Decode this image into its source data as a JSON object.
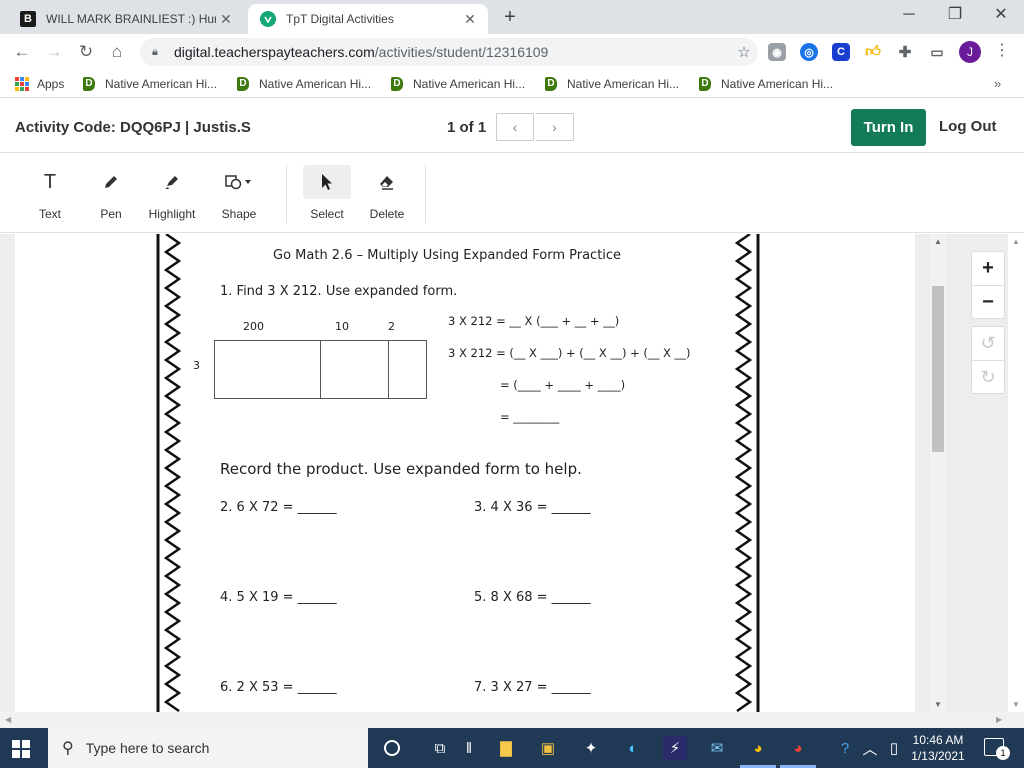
{
  "browser": {
    "tabs": [
      {
        "title": "WILL MARK BRAINLIEST :) Human",
        "favicon": "B"
      },
      {
        "title": "TpT Digital Activities",
        "favicon": "T"
      }
    ],
    "new_tab": "+",
    "url_host": "digital.teacherspayteachers.com",
    "url_path": "/activities/student/12316109",
    "profile_initial": "J",
    "extensions": [
      "incognito-icon",
      "shield-icon",
      "c-extension-icon",
      "thumbs-up-icon",
      "puzzle-icon",
      "cast-icon"
    ]
  },
  "bookmarks": {
    "apps_label": "Apps",
    "items": [
      "Native American Hi...",
      "Native American Hi...",
      "Native American Hi...",
      "Native American Hi...",
      "Native American Hi..."
    ]
  },
  "activity": {
    "code": "Activity Code: DQQ6PJ  |  Justis.S",
    "page": "1 of 1",
    "turn_in": "Turn In",
    "log_out": "Log Out"
  },
  "tools": [
    {
      "label": "Text",
      "icon": "text-icon"
    },
    {
      "label": "Pen",
      "icon": "pen-icon"
    },
    {
      "label": "Highlight",
      "icon": "highlighter-icon"
    },
    {
      "label": "Shape",
      "icon": "shape-icon"
    },
    {
      "label": "Select",
      "icon": "cursor-icon"
    },
    {
      "label": "Delete",
      "icon": "eraser-icon"
    }
  ],
  "worksheet": {
    "title": "Go Math 2.6 – Multiply Using Expanded Form Practice",
    "q1": "1.  Find 3 X 212. Use expanded form.",
    "grid_headers": [
      "200",
      "10",
      "2"
    ],
    "grid_row_label": "3",
    "equations": [
      "3 X 212 = __ X (___ + __ + __)",
      "3 X 212 = (__ X ___) + (__ X __) + (__ X __)",
      "= (____ + ____ + ____)",
      "= ________"
    ],
    "record": "Record the product. Use expanded form to help.",
    "problems": [
      "2.  6 X 72 = ______",
      "3.  4 X 36 = ______",
      "4.  5 X 19 = ______",
      "5.  8 X 68 = ______",
      "6.  2 X 53 = ______",
      "7.  3 X 27 = ______"
    ]
  },
  "zoom": {
    "in": "+",
    "out": "−"
  },
  "taskbar": {
    "search_placeholder": "Type here to search",
    "time": "10:46 AM",
    "date": "1/13/2021",
    "notification_count": "1"
  }
}
